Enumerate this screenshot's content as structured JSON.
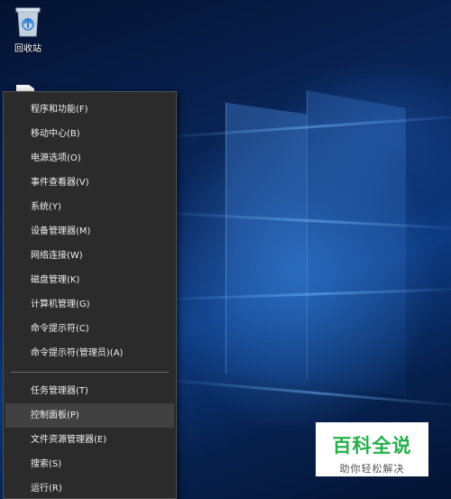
{
  "desktop": {
    "recycle_bin_label": "回收站"
  },
  "context_menu": {
    "group1": [
      {
        "label": "程序和功能(F)"
      },
      {
        "label": "移动中心(B)"
      },
      {
        "label": "电源选项(O)"
      },
      {
        "label": "事件查看器(V)"
      },
      {
        "label": "系统(Y)"
      },
      {
        "label": "设备管理器(M)"
      },
      {
        "label": "网络连接(W)"
      },
      {
        "label": "磁盘管理(K)"
      },
      {
        "label": "计算机管理(G)"
      },
      {
        "label": "命令提示符(C)"
      },
      {
        "label": "命令提示符(管理员)(A)"
      }
    ],
    "group2": [
      {
        "label": "任务管理器(T)"
      },
      {
        "label": "控制面板(P)",
        "highlighted": true
      },
      {
        "label": "文件资源管理器(E)"
      },
      {
        "label": "搜索(S)"
      },
      {
        "label": "运行(R)"
      }
    ]
  },
  "watermark": {
    "title": "百科全说",
    "subtitle": "助你轻松解决"
  },
  "colors": {
    "menu_bg": "#2b2b2b",
    "menu_hover": "#414141",
    "watermark_green": "#25b04a"
  }
}
